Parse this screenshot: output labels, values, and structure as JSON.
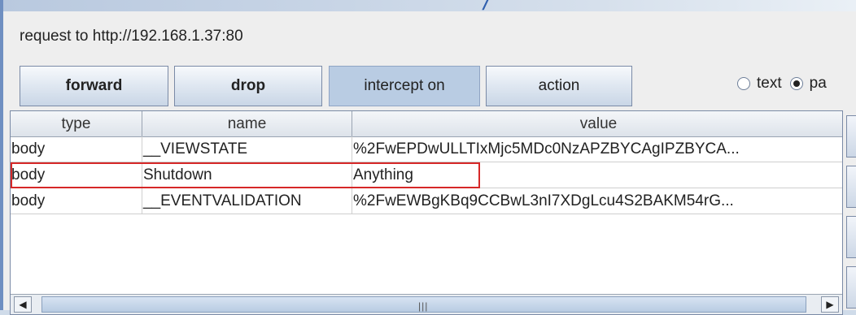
{
  "request": {
    "label": "request to http://192.168.1.37:80"
  },
  "toolbar": {
    "forward_label": "forward",
    "drop_label": "drop",
    "intercept_label": "intercept on",
    "action_label": "action"
  },
  "view_mode": {
    "options": [
      "text",
      "pa"
    ],
    "selected": "pa"
  },
  "table": {
    "headers": [
      "type",
      "name",
      "value"
    ],
    "rows": [
      {
        "type": "body",
        "name": "__VIEWSTATE",
        "value": "%2FwEPDwULLTIxMjc5MDc0NzAPZBYCAgIPZBYCA..."
      },
      {
        "type": "body",
        "name": "Shutdown",
        "value": "Anything"
      },
      {
        "type": "body",
        "name": "__EVENTVALIDATION",
        "value": "%2FwEWBgKBq9CCBwL3nI7XDgLcu4S2BAKM54rG..."
      }
    ]
  },
  "colors": {
    "highlight_border": "#d62828",
    "button_pressed": "#b9cce3"
  }
}
